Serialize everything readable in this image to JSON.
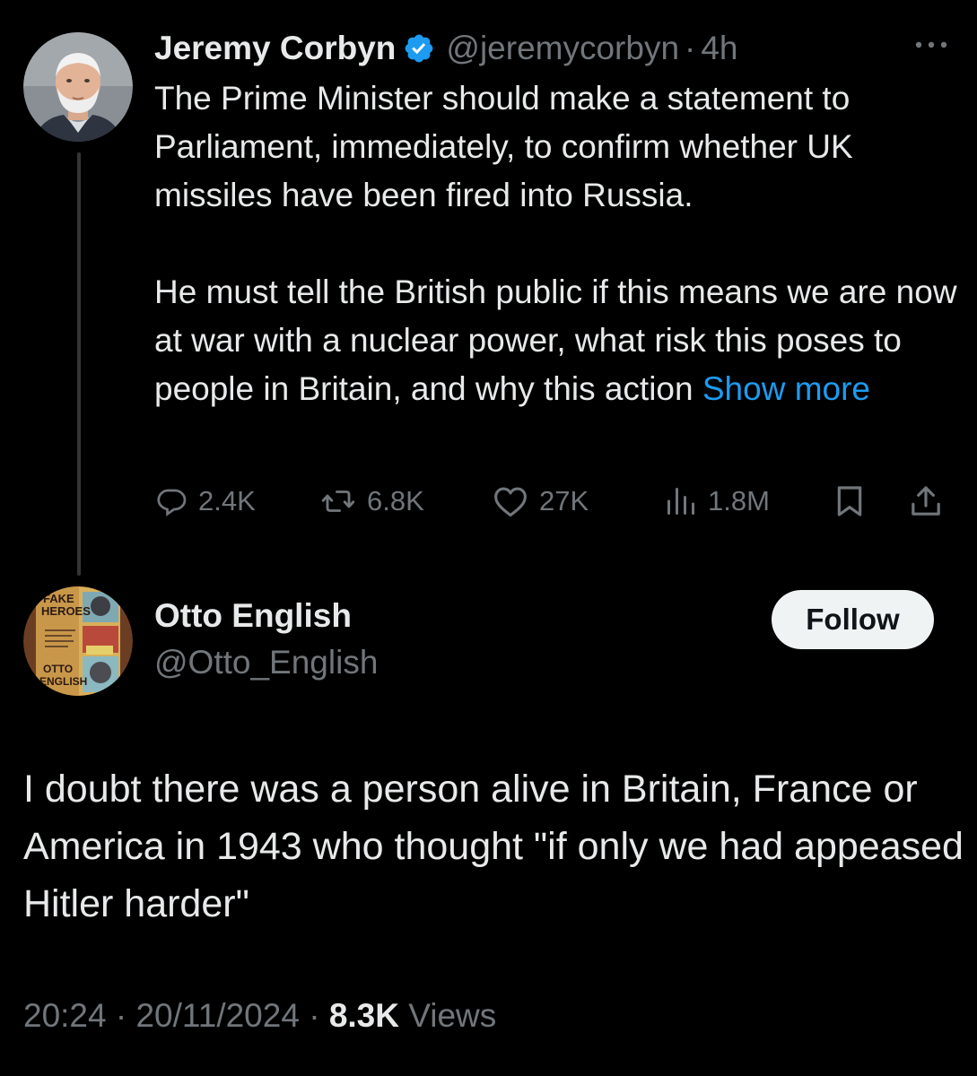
{
  "tweet1": {
    "author_name": "Jeremy Corbyn",
    "handle": "@jeremycorbyn",
    "separator": "·",
    "time": "4h",
    "text_p1": "The Prime Minister should make a statement to Parliament, immediately, to confirm whether UK missiles have been fired into Russia.",
    "text_p2": "He must tell the British public if this means we are now at war with a nuclear power, what risk this poses to people in Britain, and why this action",
    "show_more": "Show more",
    "replies": "2.4K",
    "retweets": "6.8K",
    "likes": "27K",
    "views": "1.8M",
    "icons": {
      "verified": "verified-badge-icon",
      "more": "more-options-icon",
      "reply": "reply-icon",
      "retweet": "retweet-icon",
      "like": "heart-icon",
      "views": "views-chart-icon",
      "bookmark": "bookmark-icon",
      "share": "share-icon"
    }
  },
  "tweet2": {
    "author_name": "Otto English",
    "handle": "@Otto_English",
    "follow_label": "Follow",
    "text": "I doubt there was a person alive in Britain, France or America in 1943 who thought \"if only we had appeased Hitler harder\"",
    "time": "20:24",
    "date": "20/11/2024",
    "views_count": "8.3K",
    "views_label": "Views",
    "separator": "·"
  },
  "avatar2_book": {
    "title_line1": "FAKE",
    "title_line2": "HEROES",
    "author_line1": "OTTO",
    "author_line2": "ENGLISH"
  },
  "colors": {
    "background": "#000000",
    "primary_text": "#e7e9ea",
    "secondary_text": "#71767b",
    "link": "#1d9bf0",
    "verified": "#1d9bf0",
    "thread_line": "#333639",
    "follow_bg": "#eff3f4"
  }
}
